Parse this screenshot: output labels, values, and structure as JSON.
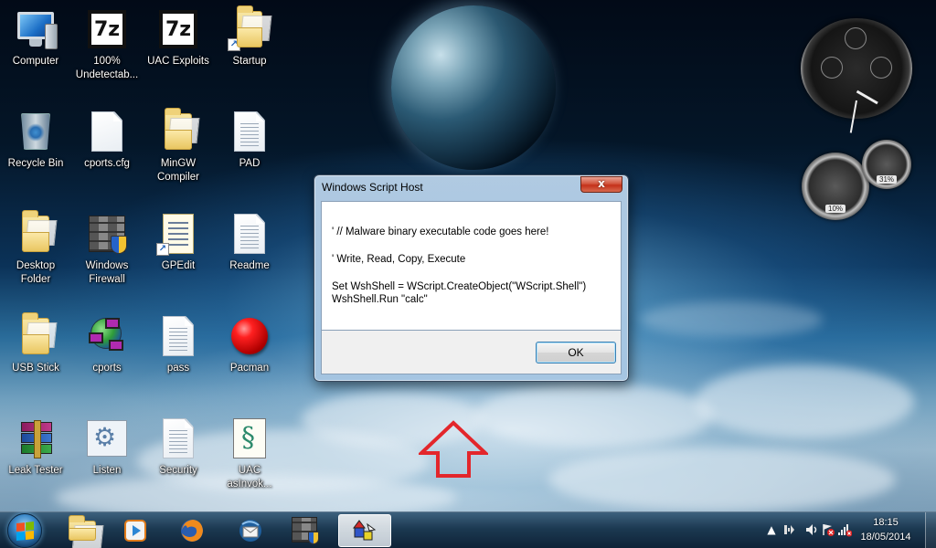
{
  "desktop": {
    "icons": [
      {
        "label": "Computer",
        "icon": "computer-icon"
      },
      {
        "label": "100%\nUndetectab...",
        "icon": "7zip-archive-icon"
      },
      {
        "label": "UAC Exploits",
        "icon": "7zip-archive-icon"
      },
      {
        "label": "Startup",
        "icon": "folder-shortcut-icon"
      },
      {
        "label": "Recycle Bin",
        "icon": "recycle-bin-icon"
      },
      {
        "label": "cports.cfg",
        "icon": "blank-file-icon"
      },
      {
        "label": "MinGW\nCompiler",
        "icon": "folder-icon"
      },
      {
        "label": "PAD",
        "icon": "text-file-icon"
      },
      {
        "label": "Desktop\nFolder",
        "icon": "folder-icon"
      },
      {
        "label": "Windows\nFirewall",
        "icon": "firewall-icon"
      },
      {
        "label": "GPEdit",
        "icon": "document-shortcut-icon"
      },
      {
        "label": "Readme",
        "icon": "text-file-icon"
      },
      {
        "label": "USB Stick",
        "icon": "folder-icon"
      },
      {
        "label": "cports",
        "icon": "cports-icon"
      },
      {
        "label": "pass",
        "icon": "text-file-icon"
      },
      {
        "label": "Pacman",
        "icon": "red-ball-icon"
      },
      {
        "label": "Leak Tester",
        "icon": "winrar-icon"
      },
      {
        "label": "Listen",
        "icon": "gear-window-icon"
      },
      {
        "label": "Security",
        "icon": "text-file-icon"
      },
      {
        "label": "UAC\nasInvok...",
        "icon": "script-file-icon"
      }
    ]
  },
  "gadgets": {
    "cpu_meter": {
      "left_value": "10%",
      "right_value": "31%"
    }
  },
  "dialog": {
    "title": "Windows Script Host",
    "close_label": "x",
    "lines": [
      "' // Malware binary executable code goes here!",
      "",
      "' Write, Read, Copy, Execute",
      "",
      "Set WshShell = WScript.CreateObject(\"WScript.Shell\")",
      "WshShell.Run \"calc\""
    ],
    "ok_label": "OK"
  },
  "taskbar": {
    "pinned": [
      {
        "icon": "windows-explorer-icon"
      },
      {
        "icon": "media-player-icon"
      },
      {
        "icon": "firefox-icon"
      },
      {
        "icon": "thunderbird-icon"
      },
      {
        "icon": "firewall-icon"
      },
      {
        "icon": "script-host-icon",
        "active": true
      }
    ],
    "tray": {
      "time": "18:15",
      "date": "18/05/2014"
    }
  },
  "colors": {
    "arrow": "#e3262b",
    "close_button": "#c4311a"
  }
}
